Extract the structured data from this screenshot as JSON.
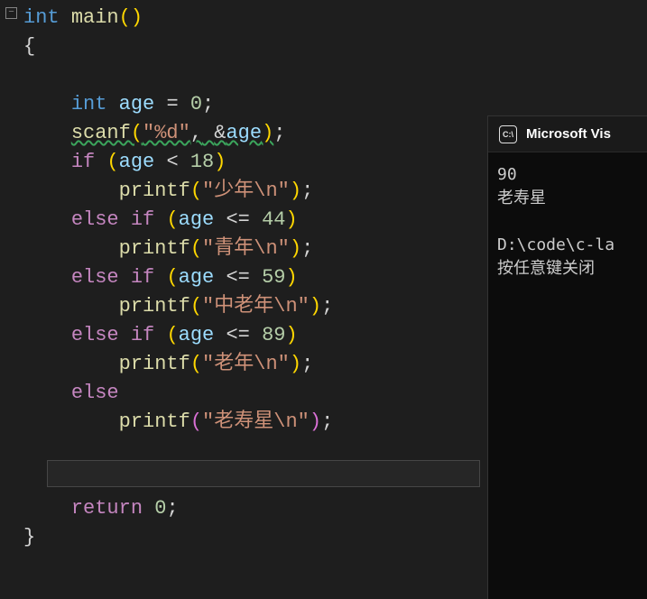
{
  "editor": {
    "fold_symbol": "−",
    "code": {
      "l1": {
        "type": "int",
        "fn": "main",
        "p1": "(",
        "p2": ")"
      },
      "l2": {
        "brace": "{"
      },
      "l3": {
        "type": "int",
        "var": "age",
        "op": "=",
        "num": "0",
        "semi": ";"
      },
      "l4": {
        "fn": "scanf",
        "p1": "(",
        "str": "\"%d\"",
        "comma": ",",
        "amp": "&",
        "var": "age",
        "p2": ")",
        "semi": ";"
      },
      "l5": {
        "kw": "if",
        "p1": "(",
        "var": "age",
        "op": "<",
        "num": "18",
        "p2": ")"
      },
      "l6": {
        "fn": "printf",
        "p1": "(",
        "str": "\"少年\\n\"",
        "p2": ")",
        "semi": ";"
      },
      "l7": {
        "kw1": "else",
        "kw2": "if",
        "p1": "(",
        "var": "age",
        "op": "<=",
        "num": "44",
        "p2": ")"
      },
      "l8": {
        "fn": "printf",
        "p1": "(",
        "str": "\"青年\\n\"",
        "p2": ")",
        "semi": ";"
      },
      "l9": {
        "kw1": "else",
        "kw2": "if",
        "p1": "(",
        "var": "age",
        "op": "<=",
        "num": "59",
        "p2": ")"
      },
      "l10": {
        "fn": "printf",
        "p1": "(",
        "str": "\"中老年\\n\"",
        "p2": ")",
        "semi": ";"
      },
      "l11": {
        "kw1": "else",
        "kw2": "if",
        "p1": "(",
        "var": "age",
        "op": "<=",
        "num": "89",
        "p2": ")"
      },
      "l12": {
        "fn": "printf",
        "p1": "(",
        "str": "\"老年\\n\"",
        "p2": ")",
        "semi": ";"
      },
      "l13": {
        "kw": "else"
      },
      "l14": {
        "fn": "printf",
        "p1": "(",
        "str": "\"老寿星\\n\"",
        "p2": ")",
        "semi": ";"
      },
      "l15": {
        "kw": "return",
        "num": "0",
        "semi": ";"
      },
      "l16": {
        "brace": "}"
      }
    }
  },
  "console": {
    "icon_text": "C:\\",
    "title": "Microsoft Vis",
    "output_line1": "90",
    "output_line2": "老寿星",
    "output_line3": "",
    "output_line4": "D:\\code\\c-la",
    "output_line5": "按任意键关闭"
  }
}
